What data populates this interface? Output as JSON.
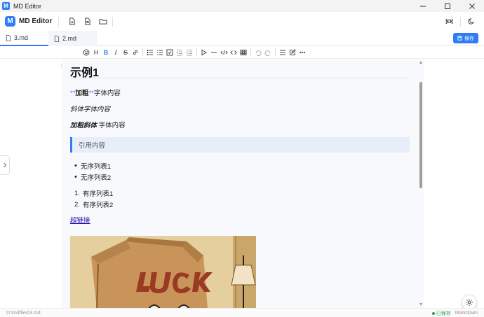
{
  "window": {
    "title": "MD Editor",
    "logo_letter": "M"
  },
  "header": {
    "app_name": "MD Editor",
    "logo_letter": "M"
  },
  "tabs": [
    {
      "label": "3.md",
      "active": true
    },
    {
      "label": "2.md",
      "active": false
    }
  ],
  "save_button": {
    "label": "保存"
  },
  "toolbar": {
    "heading": "H",
    "bold": "B",
    "italic": "I",
    "strike": "S"
  },
  "editor": {
    "line_number": "12",
    "h1": "示例1",
    "p1_marks_open": "**",
    "p1_bold": "加粗",
    "p1_marks_close": "**",
    "p1_rest": "字体内容",
    "p2": "斜体字体内容",
    "p3_bolditalic": "加粗斜体",
    "p3_rest": " 字体内容",
    "quote": "引用内容",
    "unordered": [
      "无序列表1",
      "无序列表2"
    ],
    "ordered": [
      "有序列表1",
      "有序列表2"
    ],
    "ordered_numbers": [
      "1.",
      "2."
    ],
    "link": "超链接",
    "image_text": "LUCK"
  },
  "statusbar": {
    "path": "D:\\mdfiles\\3.md",
    "saved": "已保存",
    "mode": "Markdown"
  },
  "colors": {
    "accent": "#2f7cf6",
    "saved_green": "#2e9d4f",
    "quote_bg": "#e8eef9"
  },
  "icons": [
    "new-file-icon",
    "document-icon",
    "folder-icon",
    "command-icon",
    "moon-icon",
    "settings-icon",
    "save-icon"
  ]
}
